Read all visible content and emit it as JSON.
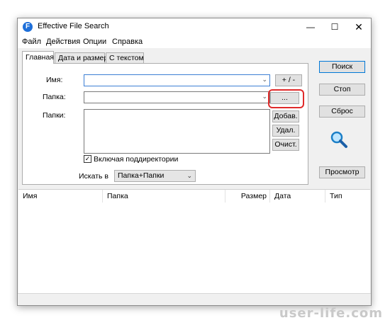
{
  "window": {
    "title": "Effective File Search",
    "icon_letter": "F"
  },
  "menu": [
    "Файл",
    "Действия",
    "Опции",
    "Справка"
  ],
  "tabs": [
    "Главная",
    "Дата и размер",
    "С текстом"
  ],
  "form": {
    "name_label": "Имя:",
    "folder_label": "Папка:",
    "folders_label": "Папки:",
    "name_value": "",
    "folder_value": "",
    "plus_minus_label": "+ / -",
    "browse_label": "...",
    "add_label": "Добав.",
    "remove_label": "Удал.",
    "clear_label": "Очист.",
    "subdirs_label": "Включая поддиректории",
    "subdirs_checked": true,
    "search_in_label": "Искать в",
    "search_in_value": "Папка+Папки"
  },
  "side_buttons": {
    "search": "Поиск",
    "stop": "Стоп",
    "reset": "Сброс",
    "view": "Просмотр"
  },
  "results": {
    "columns": [
      "Имя",
      "Папка",
      "Размер",
      "Дата",
      "Тип"
    ]
  },
  "watermark": "user-life.com"
}
